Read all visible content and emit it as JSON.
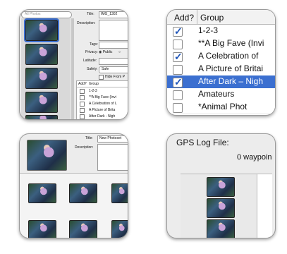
{
  "card1": {
    "search_placeholder": "All Photos",
    "title_label": "Title:",
    "title_value": "IMG_1302",
    "description_label": "Description:",
    "tags_label": "Tags:",
    "privacy_label": "Privacy:",
    "privacy_value": "Public",
    "latitude_label": "Latitude:",
    "safety_label": "Safety:",
    "safety_value": "Safe",
    "hide_label": "Hide From P",
    "add_header": "Add?",
    "group_header": "Group",
    "groups": [
      {
        "label": "1-2-3",
        "checked": false
      },
      {
        "label": "**A Big Fave (Invi",
        "checked": false
      },
      {
        "label": "A Celebration of L",
        "checked": false
      },
      {
        "label": "A Picture of Brita",
        "checked": false
      },
      {
        "label": "After Dark - Nigh",
        "checked": false
      }
    ]
  },
  "card2": {
    "add_header": "Add?",
    "group_header": "Group",
    "rows": [
      {
        "label": "1-2-3",
        "checked": true,
        "selected": false
      },
      {
        "label": "**A Big Fave (Invi",
        "checked": false,
        "selected": false
      },
      {
        "label": "A Celebration of",
        "checked": true,
        "selected": false
      },
      {
        "label": "A Picture of Britai",
        "checked": false,
        "selected": false
      },
      {
        "label": "After Dark – Nigh",
        "checked": true,
        "selected": true
      },
      {
        "label": "Amateurs",
        "checked": false,
        "selected": false
      },
      {
        "label": "*Animal Phot",
        "checked": false,
        "selected": false
      }
    ]
  },
  "card3": {
    "title_label": "Title:",
    "title_value": "New Photoset",
    "description_label": "Description:"
  },
  "card4": {
    "gps_label": "GPS Log File:",
    "waypoints_text": "0 waypoin"
  },
  "colors": {
    "selection": "#3b6fd0",
    "check": "#1f55b8",
    "card_bg": "#ececec"
  }
}
